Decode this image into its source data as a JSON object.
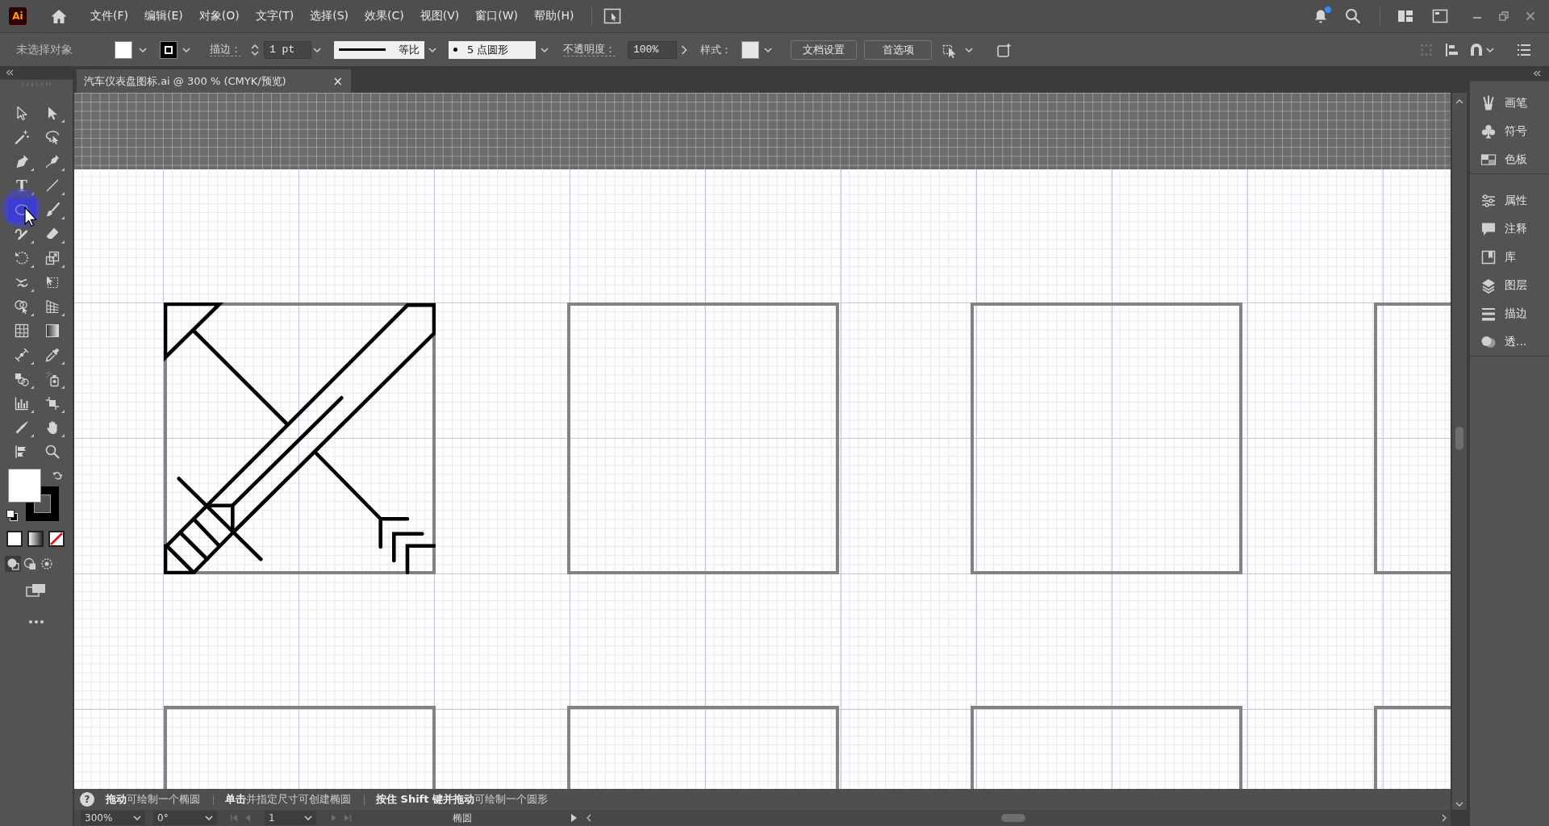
{
  "menu_bar": {
    "logo": "Ai",
    "menus": [
      "文件(F)",
      "编辑(E)",
      "对象(O)",
      "文字(T)",
      "选择(S)",
      "效果(C)",
      "视图(V)",
      "窗口(W)",
      "帮助(H)"
    ],
    "notifications": {
      "unread": true
    }
  },
  "control_bar": {
    "selection": "未选择对象",
    "fill": {
      "color": "#ffffff"
    },
    "stroke": {
      "color": "#000000"
    },
    "stroke_label": "描边：",
    "stroke_weight": "1 pt",
    "profile": "等比",
    "brush": "5 点圆形",
    "opacity_label": "不透明度：",
    "opacity": "100%",
    "style_label": "样式：",
    "style": {
      "color": "#e6e6e6"
    },
    "buttons": [
      "文档设置",
      "首选项"
    ],
    "right_tools": [
      {
        "disabled": true
      },
      {
        "disabled": false
      },
      {
        "disabled": false
      },
      {
        "disabled": false
      }
    ]
  },
  "tabs": [
    {
      "label": "汽车仪表盘图标.ai @ 300 % (CMYK/预览)",
      "close": "×",
      "selected": true
    }
  ],
  "toolbar": {
    "tools": [
      {
        "selected": false,
        "flyout": false
      },
      {
        "selected": false,
        "flyout": true
      },
      {
        "selected": false,
        "flyout": false
      },
      {
        "selected": false,
        "flyout": false
      },
      {
        "selected": false,
        "flyout": true
      },
      {
        "selected": false,
        "flyout": true
      },
      {
        "selected": false,
        "flyout": true,
        "glyph": "T"
      },
      {
        "selected": false,
        "flyout": true
      },
      {
        "selected": true,
        "flyout": true
      },
      {
        "selected": false,
        "flyout": true
      },
      {
        "selected": false,
        "flyout": true
      },
      {
        "selected": false,
        "flyout": true
      },
      {
        "selected": false,
        "flyout": true
      },
      {
        "selected": false,
        "flyout": true
      },
      {
        "selected": false,
        "flyout": true
      },
      {
        "selected": false,
        "flyout": false
      },
      {
        "selected": false,
        "flyout": true
      },
      {
        "selected": false,
        "flyout": true
      },
      {
        "selected": false,
        "flyout": false
      },
      {
        "selected": false,
        "flyout": false
      },
      {
        "selected": false,
        "flyout": true
      },
      {
        "selected": false,
        "flyout": true
      },
      {
        "selected": false,
        "flyout": true
      },
      {
        "selected": false,
        "flyout": true
      },
      {
        "selected": false,
        "flyout": true
      },
      {
        "selected": false,
        "flyout": true
      },
      {
        "selected": false,
        "flyout": true
      },
      {
        "selected": false,
        "flyout": true
      },
      {
        "selected": false,
        "flyout": false
      },
      {
        "selected": false,
        "flyout": false
      }
    ],
    "fill": {
      "color": "#ffffff"
    },
    "stroke": {
      "color": "#000000"
    },
    "draw_modes": [
      {
        "selected": true
      },
      {
        "selected": false
      },
      {
        "selected": false
      }
    ]
  },
  "canvas": {
    "frames": [
      {
        "kind": "drawing"
      },
      {
        "kind": "empty"
      },
      {
        "kind": "empty"
      },
      {
        "kind": "empty"
      },
      {
        "kind": "empty"
      },
      {
        "kind": "empty"
      },
      {
        "kind": "empty"
      },
      {
        "kind": "empty"
      }
    ]
  },
  "side_panel": {
    "groups": [
      {
        "items": [
          {
            "label": "画笔"
          },
          {
            "label": "符号"
          },
          {
            "label": "色板"
          }
        ]
      },
      {
        "items": [
          {
            "label": "属性"
          },
          {
            "label": "注释"
          },
          {
            "label": "库"
          },
          {
            "label": "图层"
          },
          {
            "label": "描边"
          },
          {
            "label": "透..."
          }
        ]
      }
    ]
  },
  "status_bar": {
    "help": "?",
    "hints": [
      "**拖动**可绘制一个椭圆",
      "**单击**并指定尺寸可创建椭圆",
      "**按住 Shift 键并拖动**可绘制一个圆形"
    ]
  },
  "bottom_bar": {
    "zoom": "300%",
    "rotation": "0°",
    "artboard_nav": [
      {
        "disabled": true
      },
      {
        "disabled": true
      },
      {
        "disabled": true
      },
      {
        "disabled": true
      }
    ],
    "artboard": "1",
    "tool_name": "椭圆"
  }
}
